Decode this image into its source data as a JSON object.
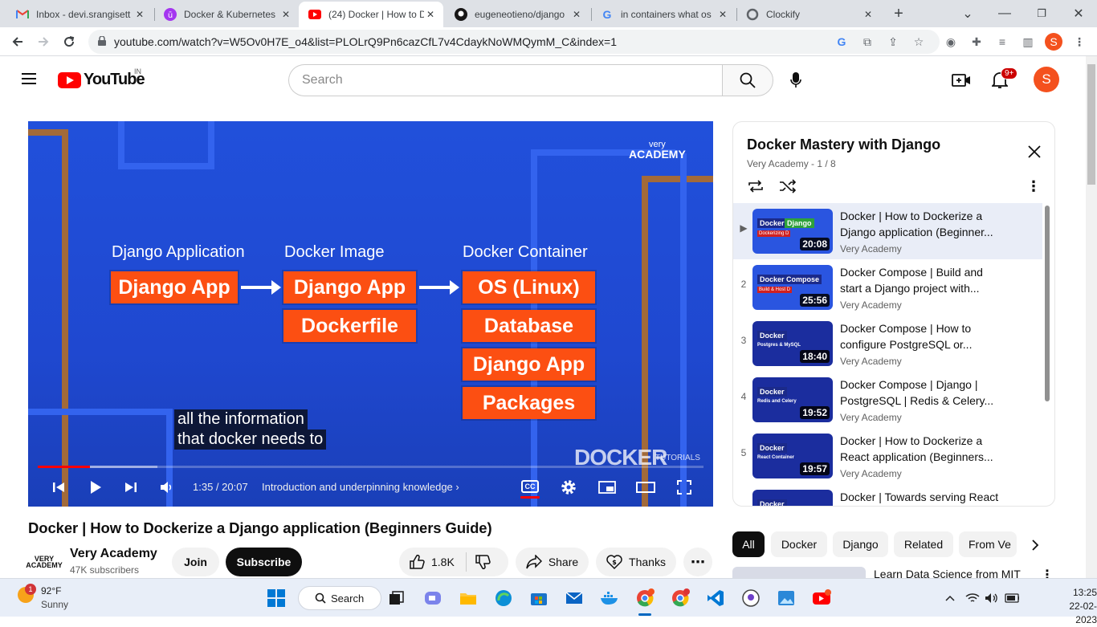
{
  "browser": {
    "tabs": [
      {
        "title": "Inbox - devi.srangisett",
        "icon": "gmail-icon"
      },
      {
        "title": "Docker & Kubernetes",
        "icon": "udemy-icon"
      },
      {
        "title": "(24) Docker | How to D",
        "icon": "youtube-icon"
      },
      {
        "title": "eugeneotieno/django",
        "icon": "github-icon"
      },
      {
        "title": "in containers what os",
        "icon": "google-icon"
      },
      {
        "title": "Clockify",
        "icon": "clockify-icon"
      }
    ],
    "url": "youtube.com/watch?v=W5Ov0H7E_o4&list=PLOLrQ9Pn6cazCfL7v4CdaykNoWMQymM_C&index=1",
    "profile_initial": "S"
  },
  "youtube": {
    "logo_text": "YouTube",
    "country_code": "IN",
    "search_placeholder": "Search",
    "notification_count": "9+",
    "avatar_initial": "S"
  },
  "player": {
    "slide": {
      "labels": [
        "Django Application",
        "Docker Image",
        "Docker Container"
      ],
      "app_box": "Django App",
      "image_boxes": [
        "Django App",
        "Dockerfile"
      ],
      "container_boxes": [
        "OS (Linux)",
        "Database",
        "Django App",
        "Packages"
      ],
      "brand_top": "very",
      "brand_bottom": "ACADEMY",
      "watermark": "DOCKER",
      "watermark_sub": "TUTORIALS"
    },
    "captions": [
      "all the information",
      "that docker needs to"
    ],
    "time": "1:35 / 20:07",
    "chapter": "Introduction and underpinning knowledge",
    "progress_played": 0.079,
    "progress_buffered": 0.18,
    "cc_label": "CC"
  },
  "video": {
    "title": "Docker | How to Dockerize a Django application (Beginners Guide)",
    "channel": "Very Academy",
    "channel_logo": "VERY ACADEMY",
    "subscribers": "47K subscribers",
    "join": "Join",
    "subscribe": "Subscribe",
    "likes": "1.8K",
    "share": "Share",
    "thanks": "Thanks"
  },
  "playlist": {
    "title": "Docker Mastery with Django",
    "subtitle": "Very Academy - 1 / 8",
    "items": [
      {
        "index": "▶",
        "title": "Docker | How to Dockerize a Django application (Beginner...",
        "channel": "Very Academy",
        "duration": "20:08",
        "thumb_a": "Docker",
        "thumb_b": "Django",
        "thumb_c": "Dockerizing D"
      },
      {
        "index": "2",
        "title": "Docker Compose | Build and start a Django project with...",
        "channel": "Very Academy",
        "duration": "25:56",
        "thumb_a": "Docker Compose",
        "thumb_b": "",
        "thumb_c": "Build & Host D"
      },
      {
        "index": "3",
        "title": "Docker Compose | How to configure PostgreSQL or...",
        "channel": "Very Academy",
        "duration": "18:40",
        "thumb_a": "Docker",
        "thumb_b": "",
        "thumb_c": "Postgres & MySQL"
      },
      {
        "index": "4",
        "title": "Docker Compose | Django | PostgreSQL | Redis & Celery...",
        "channel": "Very Academy",
        "duration": "19:52",
        "thumb_a": "Docker",
        "thumb_b": "",
        "thumb_c": "Redis and Celery"
      },
      {
        "index": "5",
        "title": "Docker | How to Dockerize a React application (Beginners...",
        "channel": "Very Academy",
        "duration": "19:57",
        "thumb_a": "Docker",
        "thumb_b": "",
        "thumb_c": "React Container"
      },
      {
        "index": "",
        "title": "Docker | Towards serving React",
        "channel": "",
        "duration": "",
        "thumb_a": "Docker",
        "thumb_b": "",
        "thumb_c": ""
      }
    ]
  },
  "chips": [
    "All",
    "Docker",
    "Django",
    "Related",
    "From Ve"
  ],
  "recommendation": {
    "title": "Learn Data Science from MIT"
  },
  "taskbar": {
    "temperature": "92°F",
    "condition": "Sunny",
    "weather_badge": "1",
    "search_label": "Search",
    "time": "13:25",
    "date": "22-02-2023"
  },
  "colors": {
    "youtube_red": "#ff0000",
    "slide_blue": "#1f49d4",
    "slide_orange": "#fc4f12",
    "subscribe_bg": "#0f0f0f"
  }
}
